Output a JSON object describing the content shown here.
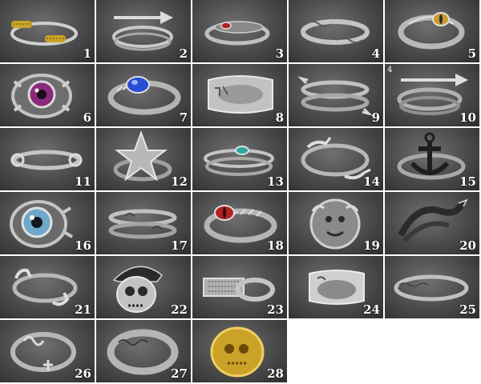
{
  "items": [
    {
      "number": "1"
    },
    {
      "number": "2"
    },
    {
      "number": "3"
    },
    {
      "number": "4"
    },
    {
      "number": "5"
    },
    {
      "number": "6"
    },
    {
      "number": "7"
    },
    {
      "number": "8"
    },
    {
      "number": "9"
    },
    {
      "number": "10",
      "tag": "4"
    },
    {
      "number": "11"
    },
    {
      "number": "12"
    },
    {
      "number": "13"
    },
    {
      "number": "14"
    },
    {
      "number": "15"
    },
    {
      "number": "16"
    },
    {
      "number": "17"
    },
    {
      "number": "18"
    },
    {
      "number": "19"
    },
    {
      "number": "20"
    },
    {
      "number": "21"
    },
    {
      "number": "22"
    },
    {
      "number": "23"
    },
    {
      "number": "24"
    },
    {
      "number": "25"
    },
    {
      "number": "26"
    },
    {
      "number": "27"
    },
    {
      "number": "28"
    }
  ],
  "colors": {
    "silver": "#c9c9c9",
    "dark_silver": "#7a7a7a",
    "gold": "#c9a227",
    "red_gem": "#b32020",
    "blue_gem": "#2a4fd6",
    "teal_gem": "#2aa8a0",
    "purple_eye": "#8a2a7a",
    "blue_eye": "#6fa8c8",
    "yellow_eye": "#c99a2a"
  }
}
